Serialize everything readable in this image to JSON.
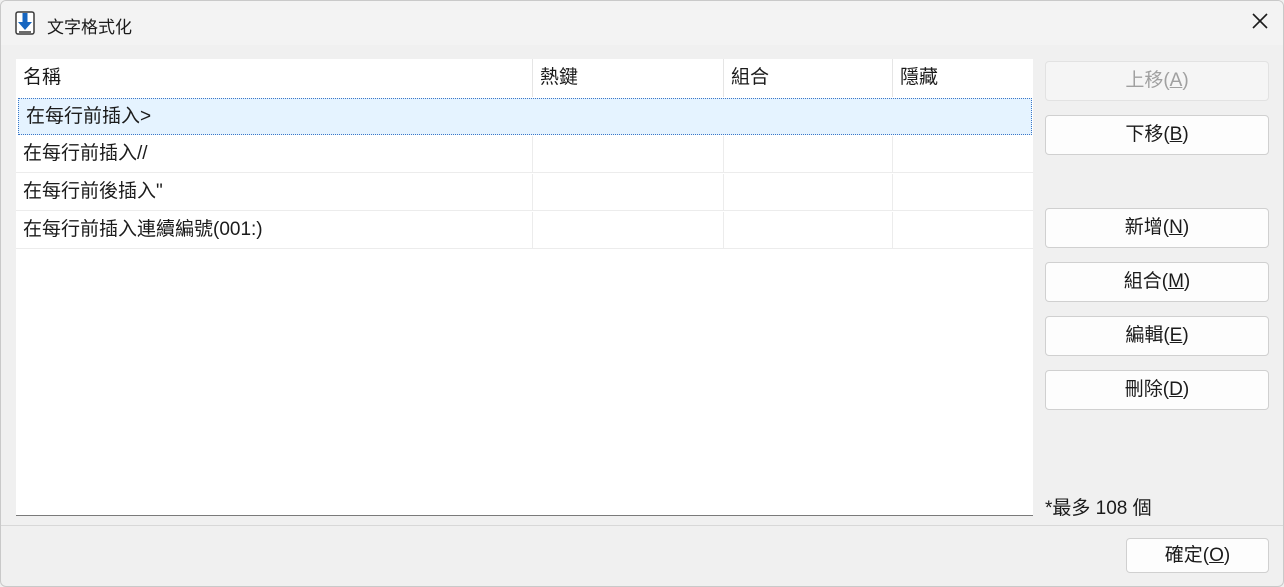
{
  "window": {
    "title": "文字格式化"
  },
  "table": {
    "columns": [
      "名稱",
      "熱鍵",
      "組合",
      "隱藏"
    ],
    "rows": [
      {
        "name": "在每行前插入>",
        "hotkey": "",
        "combo": "",
        "hidden": ""
      },
      {
        "name": "在每行前插入//",
        "hotkey": "",
        "combo": "",
        "hidden": ""
      },
      {
        "name": "在每行前後插入\"",
        "hotkey": "",
        "combo": "",
        "hidden": ""
      },
      {
        "name": "在每行前插入連續編號(001:)",
        "hotkey": "",
        "combo": "",
        "hidden": ""
      }
    ],
    "selected_index": 0
  },
  "buttons": {
    "move_up": {
      "text": "上移(",
      "key": "A",
      "end": ")"
    },
    "move_down": {
      "text": "下移(",
      "key": "B",
      "end": ")"
    },
    "add": {
      "text": "新增(",
      "key": "N",
      "end": ")"
    },
    "combine": {
      "text": "組合(",
      "key": "M",
      "end": ")"
    },
    "edit": {
      "text": "編輯(",
      "key": "E",
      "end": ")"
    },
    "delete": {
      "text": "刪除(",
      "key": "D",
      "end": ")"
    },
    "ok": {
      "text": "確定(",
      "key": "O",
      "end": ")"
    }
  },
  "note": "*最多 108 個",
  "colors": {
    "selection": "#e5f3ff",
    "accent": "#1565c0"
  }
}
